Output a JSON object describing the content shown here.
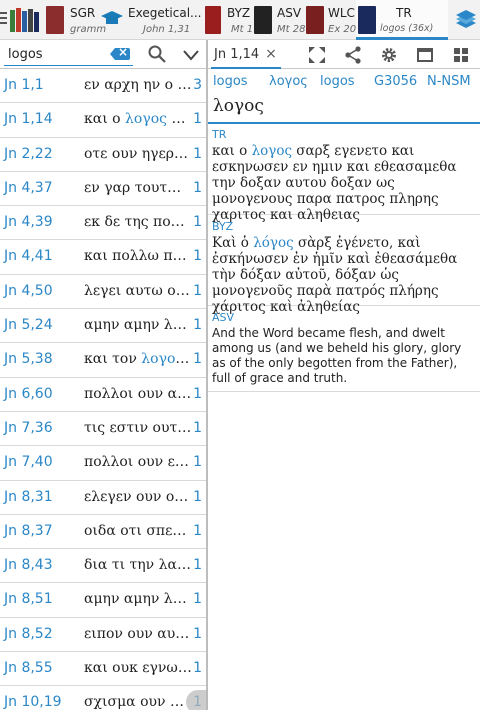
{
  "tabs": [
    {
      "label": "",
      "sub": "",
      "cover_color": "#3a3a3a"
    },
    {
      "label": "SGR",
      "sub": "gramm",
      "cover_color": "#8c2d2d"
    },
    {
      "label": "Exegetical...",
      "sub": "John 1,31",
      "cover_color": "#1a7ab8"
    },
    {
      "label": "BYZ",
      "sub": "Mt 1",
      "cover_color": "#9a1e1e"
    },
    {
      "label": "ASV",
      "sub": "Mt 28",
      "cover_color": "#222222"
    },
    {
      "label": "WLC",
      "sub": "Ex 20",
      "cover_color": "#7a1f1f"
    },
    {
      "label": "TR",
      "sub": "logos (36x)",
      "cover_color": "#1b2a5c"
    }
  ],
  "icons": {
    "menu": "menu-icon",
    "library": "books-icon",
    "search": "search-icon",
    "dropdown": "chevron-down-icon",
    "fullscreen": "fullscreen-icon",
    "share": "share-icon",
    "settings": "gear-icon",
    "window": "window-icon",
    "grid": "grid-icon"
  },
  "colors": {
    "accent": "#2b87c7",
    "text": "#222222"
  },
  "search": {
    "value": "logos",
    "placeholder": ""
  },
  "results": [
    {
      "ref": "Jn 1,1",
      "pre": "εν αρχη ην ο ",
      "hit": "λ…",
      "post": "",
      "count": "3"
    },
    {
      "ref": "Jn 1,14",
      "pre": "και ο ",
      "hit": "λογος",
      "post": " σα…",
      "count": "1"
    },
    {
      "ref": "Jn 2,22",
      "pre": "οτε ουν ηγερθη…",
      "hit": "",
      "post": "",
      "count": "1"
    },
    {
      "ref": "Jn 4,37",
      "pre": "εν γαρ τουτω ο…",
      "hit": "",
      "post": "",
      "count": "1"
    },
    {
      "ref": "Jn 4,39",
      "pre": "εκ δε της πολε…",
      "hit": "",
      "post": "",
      "count": "1"
    },
    {
      "ref": "Jn 4,41",
      "pre": "και πολλω πλει…",
      "hit": "",
      "post": "",
      "count": "1"
    },
    {
      "ref": "Jn 4,50",
      "pre": "λεγει αυτω ο ι…",
      "hit": "",
      "post": "",
      "count": "1"
    },
    {
      "ref": "Jn 5,24",
      "pre": "αμην αμην λε…",
      "hit": "",
      "post": "",
      "count": "1"
    },
    {
      "ref": "Jn 5,38",
      "pre": "και τον ",
      "hit": "λογον",
      "post": " …",
      "count": "1"
    },
    {
      "ref": "Jn 6,60",
      "pre": "πολλοι ουν ακο…",
      "hit": "",
      "post": "",
      "count": "1"
    },
    {
      "ref": "Jn 7,36",
      "pre": "τις εστιν ουτος…",
      "hit": "",
      "post": "",
      "count": "1"
    },
    {
      "ref": "Jn 7,40",
      "pre": "πολλοι ουν εκ τ…",
      "hit": "",
      "post": "",
      "count": "1"
    },
    {
      "ref": "Jn 8,31",
      "pre": "ελεγεν ουν ο ι…",
      "hit": "",
      "post": "",
      "count": "1"
    },
    {
      "ref": "Jn 8,37",
      "pre": "οιδα οτι σπερμ…",
      "hit": "",
      "post": "",
      "count": "1"
    },
    {
      "ref": "Jn 8,43",
      "pre": "δια τι την λαλι…",
      "hit": "",
      "post": "",
      "count": "1"
    },
    {
      "ref": "Jn 8,51",
      "pre": "αμην αμην λεγ…",
      "hit": "",
      "post": "",
      "count": "1"
    },
    {
      "ref": "Jn 8,52",
      "pre": "ειπον ουν αυτ…",
      "hit": "",
      "post": "",
      "count": "1"
    },
    {
      "ref": "Jn 8,55",
      "pre": "και ουκ εγνωκ…",
      "hit": "",
      "post": "",
      "count": "1"
    },
    {
      "ref": "Jn 10,19",
      "pre": "σχισμα ουν πα…",
      "hit": "",
      "post": "",
      "count": "1"
    }
  ],
  "detail": {
    "tab_label": "Jn 1,14",
    "close_glyph": "×",
    "lexicon": {
      "word": "logos",
      "lemma_greek": "λογος",
      "translit": "logos",
      "strong": "G3056",
      "parse": "N-NSM"
    },
    "lemma": "λογος",
    "verses": [
      {
        "label": "TR",
        "pre": "και ο ",
        "hit": "λογος",
        "post": " σαρξ εγενετο και εσκηνωσεν εν ημιν και εθεασαμεθα την δοξαν αυτου δοξαν ως μονογενους παρα πατρος πληρης χαριτος και αληθειας"
      },
      {
        "label": "BYZ",
        "pre": "Καὶ ὁ ",
        "hit": "λόγος",
        "post": " σὰρξ ἐγένετο, καὶ ἐσκήνωσεν ἐν ἡμῖν καὶ ἐθεασάμεθα τὴν δόξαν αὐτοῦ, δόξαν ὡς μονογενοῦς παρὰ πατρός πλήρης χάριτος καὶ ἀληθείας"
      },
      {
        "label": "ASV",
        "pre": "And the Word became flesh, and dwelt among us (and we beheld his glory, glory as of the only begotten from the Father), full of grace and truth.",
        "hit": "",
        "post": ""
      }
    ]
  }
}
